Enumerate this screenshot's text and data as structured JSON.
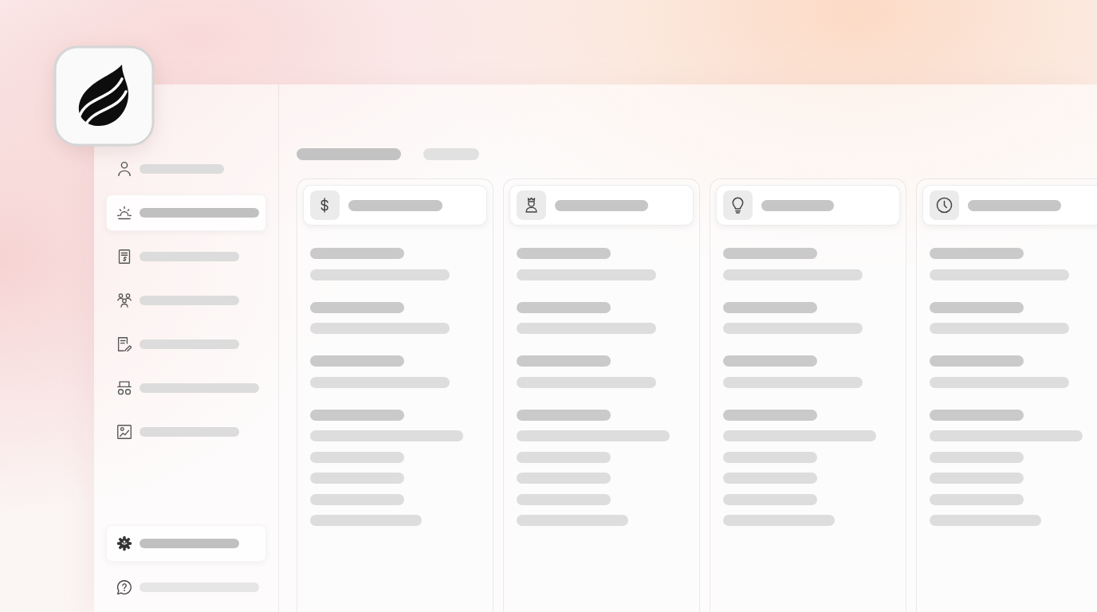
{
  "sidebar": {
    "items": [
      {
        "selected": false
      },
      {
        "selected": true
      },
      {
        "selected": false
      },
      {
        "selected": false
      },
      {
        "selected": false
      },
      {
        "selected": false
      },
      {
        "selected": false
      }
    ],
    "footer_items": [
      {
        "selected": true
      },
      {
        "selected": false
      }
    ]
  },
  "content": {
    "tabs": [
      {
        "selected": true
      },
      {
        "selected": false
      }
    ],
    "columns": [
      {
        "lines": [
          {
            "kind": "heading"
          },
          {
            "kind": "line"
          },
          {
            "kind": "heading"
          },
          {
            "kind": "line"
          },
          {
            "kind": "heading"
          },
          {
            "kind": "line"
          },
          {
            "kind": "heading"
          },
          {
            "kind": "long"
          },
          {
            "kind": "short"
          },
          {
            "kind": "short"
          },
          {
            "kind": "short"
          },
          {
            "kind": "medium"
          }
        ]
      },
      {
        "lines": [
          {
            "kind": "heading"
          },
          {
            "kind": "line"
          },
          {
            "kind": "heading"
          },
          {
            "kind": "line"
          },
          {
            "kind": "heading"
          },
          {
            "kind": "line"
          },
          {
            "kind": "heading"
          },
          {
            "kind": "long"
          },
          {
            "kind": "short"
          },
          {
            "kind": "short"
          },
          {
            "kind": "short"
          },
          {
            "kind": "medium"
          }
        ]
      },
      {
        "lines": [
          {
            "kind": "heading"
          },
          {
            "kind": "line"
          },
          {
            "kind": "heading"
          },
          {
            "kind": "line"
          },
          {
            "kind": "heading"
          },
          {
            "kind": "line"
          },
          {
            "kind": "heading"
          },
          {
            "kind": "long"
          },
          {
            "kind": "short"
          },
          {
            "kind": "short"
          },
          {
            "kind": "short"
          },
          {
            "kind": "medium"
          }
        ]
      },
      {
        "lines": [
          {
            "kind": "heading"
          },
          {
            "kind": "line"
          },
          {
            "kind": "heading"
          },
          {
            "kind": "line"
          },
          {
            "kind": "heading"
          },
          {
            "kind": "line"
          },
          {
            "kind": "heading"
          },
          {
            "kind": "long"
          },
          {
            "kind": "short"
          },
          {
            "kind": "short"
          },
          {
            "kind": "short"
          },
          {
            "kind": "medium"
          }
        ]
      }
    ]
  }
}
